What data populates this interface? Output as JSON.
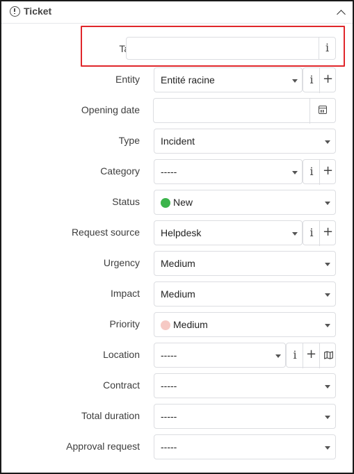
{
  "panel": {
    "title": "Ticket",
    "collapse_icon": "chevron-up-icon",
    "title_icon": "alert-circle-icon"
  },
  "fields": {
    "tags": {
      "label": "Tags",
      "value": ""
    },
    "entity": {
      "label": "Entity",
      "value": "Entité racine"
    },
    "opening_date": {
      "label": "Opening date",
      "value": ""
    },
    "type": {
      "label": "Type",
      "value": "Incident"
    },
    "category": {
      "label": "Category",
      "value": "-----"
    },
    "status": {
      "label": "Status",
      "value": "New",
      "dot_color": "#3cb44b"
    },
    "request_source": {
      "label": "Request source",
      "value": "Helpdesk"
    },
    "urgency": {
      "label": "Urgency",
      "value": "Medium"
    },
    "impact": {
      "label": "Impact",
      "value": "Medium"
    },
    "priority": {
      "label": "Priority",
      "value": "Medium",
      "dot_color": "#f6c9c4"
    },
    "location": {
      "label": "Location",
      "value": "-----"
    },
    "contract": {
      "label": "Contract",
      "value": "-----"
    },
    "total_duration": {
      "label": "Total duration",
      "value": "-----"
    },
    "approval_request": {
      "label": "Approval request",
      "value": "-----"
    }
  },
  "glyphs": {
    "info": "i",
    "plus": "+"
  },
  "colors": {
    "highlight": "#e0262a",
    "border": "#dcdde1"
  }
}
